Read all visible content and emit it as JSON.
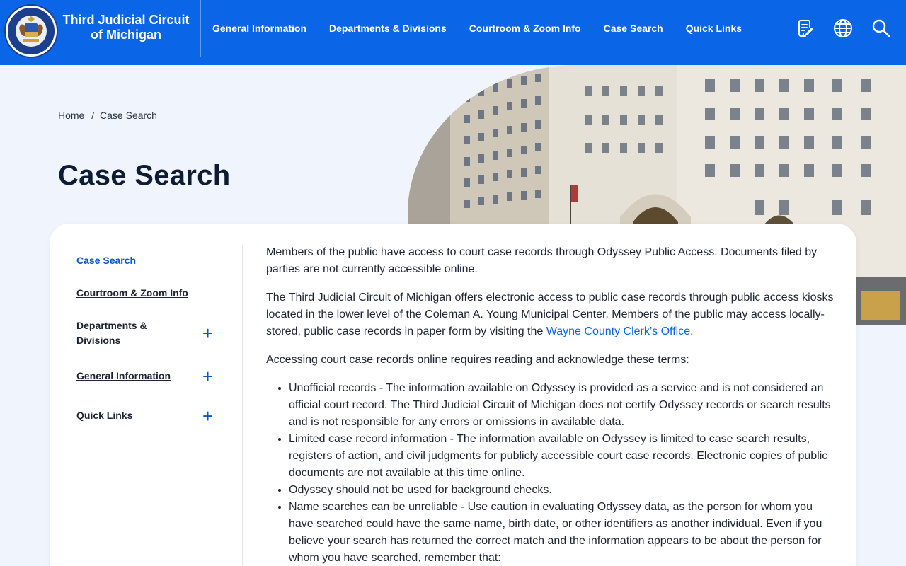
{
  "brand": {
    "title_line1": "Third Judicial Circuit",
    "title_line2": "of Michigan",
    "seal_text_top": "THIRD JUDICIAL CIRCUIT",
    "seal_text_bottom": "OF MICHIGAN"
  },
  "nav": {
    "items": [
      "General Information",
      "Departments & Divisions",
      "Courtroom & Zoom Info",
      "Case Search",
      "Quick Links"
    ]
  },
  "header_icons": [
    "document-edit-icon",
    "globe-icon",
    "search-icon"
  ],
  "breadcrumb": {
    "home": "Home",
    "separator": "/",
    "current": "Case Search"
  },
  "page_title": "Case Search",
  "sidebar": {
    "items": [
      {
        "label": "Case Search",
        "active": true,
        "expandable": false
      },
      {
        "label": "Courtroom & Zoom Info",
        "active": false,
        "expandable": false
      },
      {
        "label": "Departments & Divisions",
        "active": false,
        "expandable": true
      },
      {
        "label": "General Information",
        "active": false,
        "expandable": true
      },
      {
        "label": "Quick Links",
        "active": false,
        "expandable": true
      }
    ],
    "expand_symbol": "+"
  },
  "content": {
    "p1": "Members of the public have access to court case records through Odyssey Public Access. Documents filed by parties are not currently accessible online.",
    "p2_text": "The Third Judicial Circuit of Michigan offers electronic access to public case records through public access kiosks located in the lower level of the Coleman A. Young Municipal Center. Members of the public may access locally-stored, public case records in paper form by visiting the ",
    "p2_link": "Wayne County Clerk’s Office",
    "p2_end": ".",
    "p3": "Accessing court case records online requires reading and acknowledge these terms:",
    "bullets": [
      "Unofficial records - The information available on Odyssey is provided as a service and is not considered an official court record. The Third Judicial Circuit of Michigan does not certify Odyssey records or search results and is not responsible for any errors or omissions in available data.",
      "Limited case record information - The information available on Odyssey is limited to case search results, registers of action, and civil judgments for publicly accessible court case records. Electronic copies of public documents are not available at this time online.",
      "Odyssey should not be used for background checks.",
      "Name searches can be unreliable - Use caution in evaluating Odyssey data, as the person for whom you have searched could have the same name, birth date, or other identifiers as another individual. Even if you believe your search has returned the correct match and the information appears to be about the person for whom you have searched, remember that:"
    ]
  },
  "colors": {
    "header_blue": "#0a66e6",
    "link_blue": "#0a66e6",
    "page_bg": "#f0f5fd",
    "active_nav": "#0a57c7"
  }
}
